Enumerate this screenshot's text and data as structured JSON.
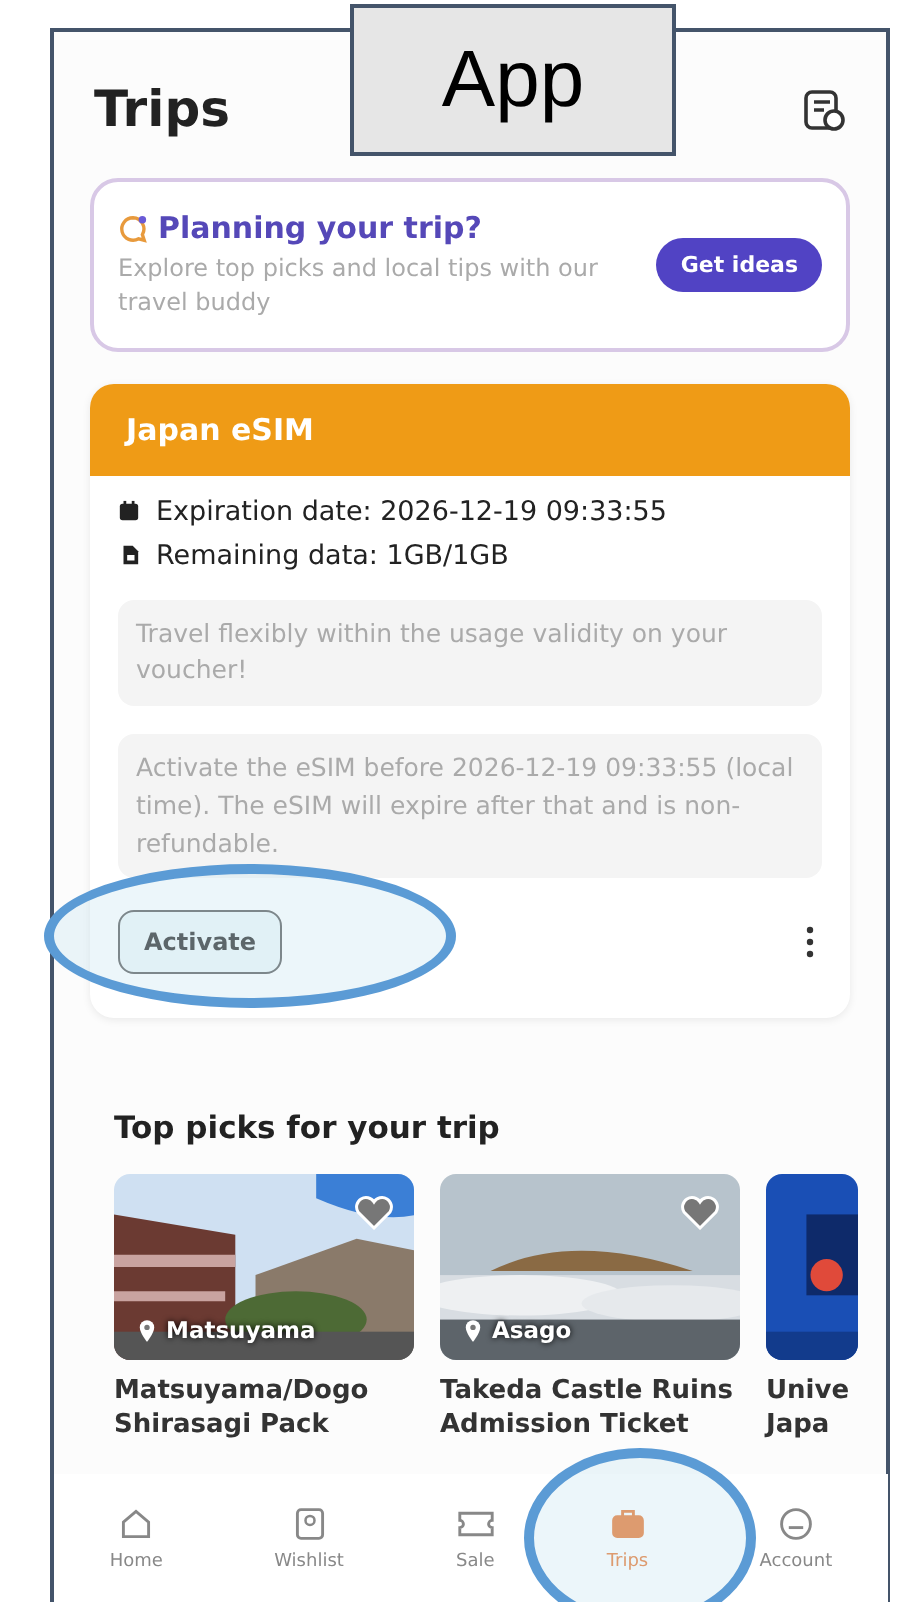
{
  "overlay_label": "App",
  "header": {
    "title": "Trips"
  },
  "promo": {
    "title": "Planning your trip?",
    "text": "Explore top picks and local tips with our travel buddy",
    "button": "Get ideas"
  },
  "esim": {
    "title": "Japan eSIM",
    "details": [
      {
        "kind": "calendar",
        "text": "Expiration date: 2026-12-19 09:33:55"
      },
      {
        "kind": "sim",
        "text": "Remaining data: 1GB/1GB"
      }
    ],
    "notes": [
      "Travel flexibly within the usage validity on your voucher!",
      "Activate the eSIM before 2026-12-19 09:33:55 (local time). The eSIM will expire after that and is non-refundable."
    ],
    "button": "Activate"
  },
  "top_picks": {
    "title": "Top picks for your trip",
    "cards": [
      {
        "location": "Matsuyama",
        "title": "Matsuyama/Dogo Shirasagi Pack"
      },
      {
        "location": "Asago",
        "title": "Takeda Castle Ruins Admission Ticket"
      },
      {
        "title": "Unive Japa"
      }
    ]
  },
  "nav": [
    {
      "kind": "home",
      "label": "Home",
      "selected": false
    },
    {
      "kind": "wishlist",
      "label": "Wishlist",
      "selected": false
    },
    {
      "kind": "sale",
      "label": "Sale",
      "selected": false
    },
    {
      "kind": "trips",
      "label": "Trips",
      "selected": true
    },
    {
      "kind": "account",
      "label": "Account",
      "selected": false
    }
  ]
}
